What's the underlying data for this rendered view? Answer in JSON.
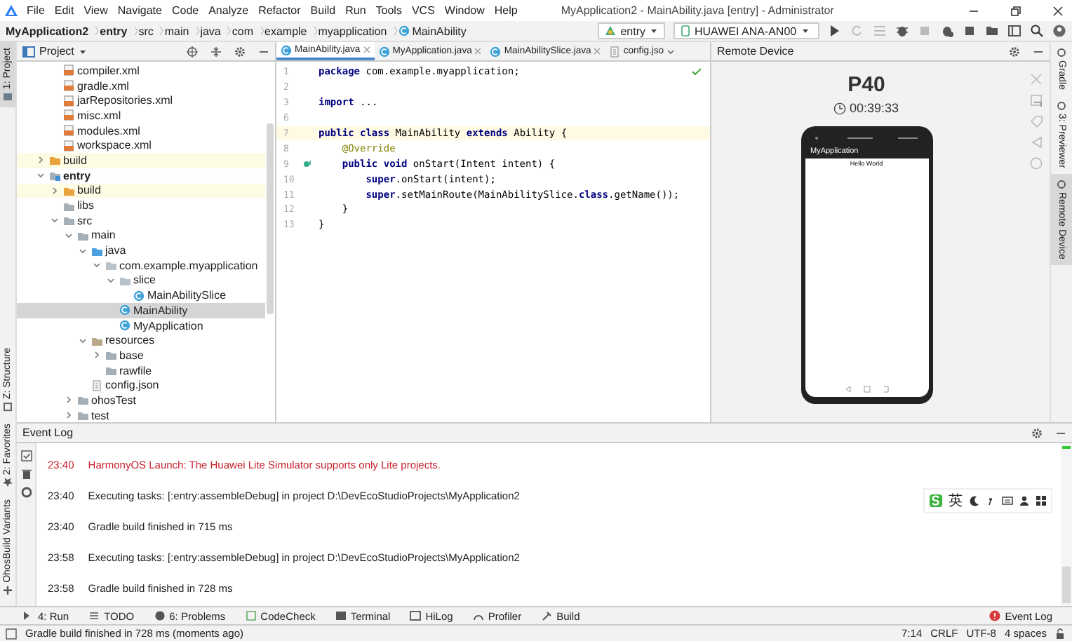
{
  "window": {
    "title": "MyApplication2 - MainAbility.java [entry] - Administrator"
  },
  "menu": [
    "File",
    "Edit",
    "View",
    "Navigate",
    "Code",
    "Analyze",
    "Refactor",
    "Build",
    "Run",
    "Tools",
    "VCS",
    "Window",
    "Help"
  ],
  "breadcrumb": [
    {
      "label": "MyApplication2",
      "kind": "module"
    },
    {
      "label": "entry",
      "kind": "module"
    },
    {
      "label": "src",
      "kind": "folder"
    },
    {
      "label": "main",
      "kind": "folder"
    },
    {
      "label": "java",
      "kind": "folder"
    },
    {
      "label": "com",
      "kind": "folder"
    },
    {
      "label": "example",
      "kind": "folder"
    },
    {
      "label": "myapplication",
      "kind": "folder"
    },
    {
      "label": "MainAbility",
      "kind": "class"
    }
  ],
  "run_config": {
    "module": "entry",
    "device": "HUAWEI ANA-AN00"
  },
  "left_tool_windows": {
    "top": [
      {
        "label": "1: Project",
        "selected": true
      }
    ],
    "bottom": [
      {
        "label": "Z: Structure",
        "selected": false
      },
      {
        "label": "2: Favorites",
        "selected": false
      },
      {
        "label": "OhosBuild Variants",
        "selected": false
      }
    ]
  },
  "right_tool_windows": [
    {
      "label": "Gradle",
      "selected": false
    },
    {
      "label": "3: Previewer",
      "selected": false
    },
    {
      "label": "Remote Device",
      "selected": true
    }
  ],
  "project_panel": {
    "title": "Project",
    "tree": [
      {
        "children": [
          {
            "label": "compiler.xml",
            "kind": "xml-file",
            "selected": false
          },
          {
            "label": "gradle.xml",
            "kind": "xml-file",
            "selected": false
          },
          {
            "label": "jarRepositories.xml",
            "kind": "xml-file",
            "selected": false
          },
          {
            "label": "misc.xml",
            "kind": "xml-file",
            "selected": false
          },
          {
            "label": "modules.xml",
            "kind": "xml-file",
            "selected": false
          },
          {
            "label": "workspace.xml",
            "kind": "xml-file",
            "selected": false
          }
        ]
      },
      {
        "label": "build",
        "kind": "excluded-folder",
        "expanded": false,
        "selected": false
      },
      {
        "label": "entry",
        "kind": "module",
        "expanded": true,
        "selected": false,
        "children": [
          {
            "label": "build",
            "kind": "excluded-folder",
            "expanded": false,
            "selected": false
          },
          {
            "label": "libs",
            "kind": "folder",
            "selected": false
          },
          {
            "label": "src",
            "kind": "folder",
            "expanded": true,
            "selected": false,
            "children": [
              {
                "label": "main",
                "kind": "folder",
                "expanded": true,
                "selected": false,
                "children": [
                  {
                    "label": "java",
                    "kind": "source-folder",
                    "expanded": true,
                    "selected": false,
                    "children": [
                      {
                        "label": "com.example.myapplication",
                        "kind": "package",
                        "expanded": true,
                        "selected": false,
                        "children": [
                          {
                            "label": "slice",
                            "kind": "package",
                            "expanded": true,
                            "selected": false,
                            "children": [
                              {
                                "label": "MainAbilitySlice",
                                "kind": "class",
                                "selected": false
                              }
                            ]
                          },
                          {
                            "label": "MainAbility",
                            "kind": "class",
                            "selected": true
                          },
                          {
                            "label": "MyApplication",
                            "kind": "class",
                            "selected": false
                          }
                        ]
                      }
                    ]
                  },
                  {
                    "label": "resources",
                    "kind": "resource-folder",
                    "expanded": true,
                    "selected": false,
                    "children": [
                      {
                        "label": "base",
                        "kind": "folder",
                        "expanded": false,
                        "selected": false
                      },
                      {
                        "label": "rawfile",
                        "kind": "folder",
                        "selected": false
                      }
                    ]
                  },
                  {
                    "label": "config.json",
                    "kind": "json-file",
                    "selected": false
                  }
                ]
              },
              {
                "label": "ohosTest",
                "kind": "folder",
                "expanded": false,
                "selected": false
              },
              {
                "label": "test",
                "kind": "folder",
                "expanded": false,
                "selected": false
              }
            ]
          }
        ]
      }
    ]
  },
  "editor": {
    "tabs": [
      {
        "label": "MainAbility.java",
        "kind": "class",
        "selected": true
      },
      {
        "label": "MyApplication.java",
        "kind": "class",
        "selected": false
      },
      {
        "label": "MainAbilitySlice.java",
        "kind": "class",
        "selected": false
      },
      {
        "label": "config.jso",
        "kind": "json-file",
        "selected": false
      }
    ],
    "lines": [
      {
        "number": "1",
        "code": "**package** com.example.myapplication;",
        "kind": "code",
        "current": false
      },
      {
        "number": "2",
        "current": false
      },
      {
        "number": "3",
        "code": "**import** ...",
        "kind": "code",
        "current": false
      },
      {
        "number": "6",
        "current": false
      },
      {
        "number": "7",
        "code": "**public class** MainAbility **extends** Ability {",
        "kind": "code",
        "current": true
      },
      {
        "number": "8",
        "code": "    @Override",
        "kind": "annotation",
        "current": false
      },
      {
        "number": "9",
        "code": "    **public void** onStart(Intent intent) {",
        "kind": "code",
        "current": false,
        "override": true
      },
      {
        "number": "10",
        "code": "        **super**.onStart(intent);",
        "kind": "code",
        "current": false
      },
      {
        "number": "11",
        "code": "        **super**.setMainRoute(MainAbilitySlice.**class**.getName());",
        "kind": "code",
        "current": false
      },
      {
        "number": "12",
        "code": "    }",
        "kind": "code",
        "current": false
      },
      {
        "number": "13",
        "code": "}",
        "kind": "code",
        "current": false
      }
    ]
  },
  "remote_device": {
    "title": "Remote Device",
    "device": "P40",
    "timer": "00:39:33",
    "app_title": "MyApplication",
    "app_text": "Hello World"
  },
  "event_log": {
    "title": "Event Log",
    "entries": [
      {
        "time": "23:40",
        "message": "HarmonyOS Launch: The Huawei Lite Simulator supports only Lite projects.",
        "kind": "error"
      },
      {
        "time": "23:40",
        "message": "Executing tasks: [:entry:assembleDebug] in project D:\\DevEcoStudioProjects\\MyApplication2",
        "kind": "info"
      },
      {
        "time": "23:40",
        "message": "Gradle build finished in 715 ms",
        "kind": "info"
      },
      {
        "time": "23:58",
        "message": "Executing tasks: [:entry:assembleDebug] in project D:\\DevEcoStudioProjects\\MyApplication2",
        "kind": "info"
      },
      {
        "time": "23:58",
        "message": "Gradle build finished in 728 ms",
        "kind": "info"
      }
    ]
  },
  "ime_toolbar": {
    "mode": "英"
  },
  "tool_buttons": [
    {
      "label": "4: Run",
      "kind": "run"
    },
    {
      "label": "TODO",
      "kind": "todo"
    },
    {
      "label": "6: Problems",
      "kind": "problems"
    },
    {
      "label": "CodeCheck",
      "kind": "codecheck"
    },
    {
      "label": "Terminal",
      "kind": "terminal"
    },
    {
      "label": "HiLog",
      "kind": "hilog"
    },
    {
      "label": "Profiler",
      "kind": "profiler"
    },
    {
      "label": "Build",
      "kind": "build"
    }
  ],
  "event_log_button": {
    "label": "Event Log",
    "alert": true
  },
  "status_bar": {
    "message": "Gradle build finished in 728 ms (moments ago)",
    "position": "7:14",
    "line_ending": "CRLF",
    "encoding": "UTF-8",
    "indent": "4 spaces"
  }
}
